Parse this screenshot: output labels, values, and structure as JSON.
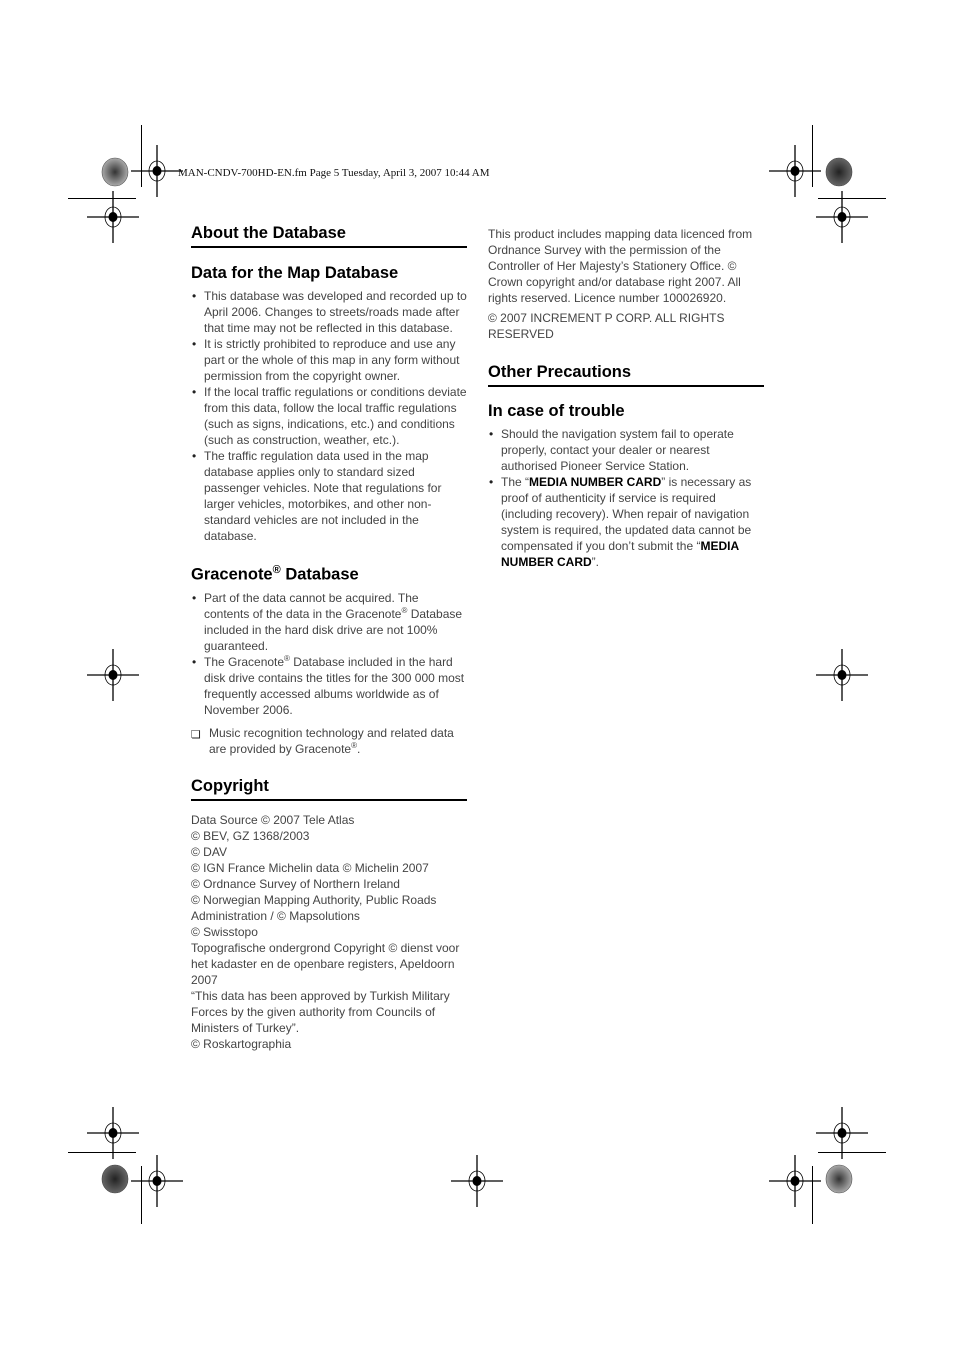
{
  "header": {
    "file_info": "MAN-CNDV-700HD-EN.fm  Page 5  Tuesday, April 3, 2007  10:44 AM"
  },
  "left_column": {
    "about_title": "About the Database",
    "map_db": {
      "title": "Data for the Map Database",
      "bullets": [
        "This database was developed and recorded up to April 2006. Changes to streets/roads made after that time may not be reflected in this database.",
        "It is strictly prohibited to reproduce and use any part or the whole of this map in any form without permission from the copyright owner.",
        "If the local traffic regulations or conditions deviate from this data, follow the local traffic regulations (such as signs, indications, etc.) and conditions (such as construction, weather, etc.).",
        "The traffic regulation data used in the map database applies only to standard sized passenger vehicles. Note that regulations for larger vehicles, motorbikes, and other non-standard vehicles are not included in the database."
      ]
    },
    "gracenote": {
      "title_main": "Gracenote",
      "title_reg": "®",
      "title_rest": " Database",
      "bullet1_a": "Part of the data cannot be acquired. The contents of the data in the Gracenote",
      "bullet1_b": " Database included in the hard disk drive are not 100% guaranteed.",
      "bullet2_a": "The Gracenote",
      "bullet2_b": " Database included in the hard disk drive contains the titles for the 300 000 most frequently accessed albums worldwide as of November 2006.",
      "note_icon": "checkbox-note-icon",
      "note_a": "Music recognition technology and related data are provided by Gracenote",
      "note_b": ".",
      "reg": "®"
    },
    "copyright": {
      "title": "Copyright",
      "lines": [
        "Data Source © 2007 Tele Atlas",
        "© BEV, GZ 1368/2003",
        "© DAV",
        "© IGN France Michelin data © Michelin 2007",
        "© Ordnance Survey of Northern Ireland",
        "© Norwegian Mapping Authority, Public Roads Administration / © Mapsolutions",
        "© Swisstopo",
        "Topografische ondergrond Copyright © dienst voor het kadaster en de openbare registers, Apeldoorn 2007",
        "“This data has been approved by Turkish Military Forces by the given authority from Councils of Ministers of Turkey”.",
        "© Roskartographia"
      ]
    }
  },
  "right_column": {
    "os_notice": "This product includes mapping data licenced from Ordnance Survey with the permission of the Controller of Her Majesty’s Stationery Office. © Crown copyright and/or database right 2007. All rights reserved. Licence number 100026920.",
    "increment_notice": "© 2007 INCREMENT P CORP. ALL RIGHTS RESERVED",
    "other_title": "Other Precautions",
    "trouble": {
      "title": "In case of trouble",
      "bullet1": "Should the navigation system fail to operate properly, contact your dealer or nearest authorised Pioneer Service Station.",
      "bullet2_a": "The “",
      "bullet2_bold1": "MEDIA NUMBER CARD",
      "bullet2_b": "” is necessary as proof of authenticity if service is required (including recovery). When repair of navigation system is required, the updated data cannot be compensated if you don’t submit the “",
      "bullet2_bold2": "MEDIA NUMBER CARD",
      "bullet2_c": "”."
    }
  }
}
